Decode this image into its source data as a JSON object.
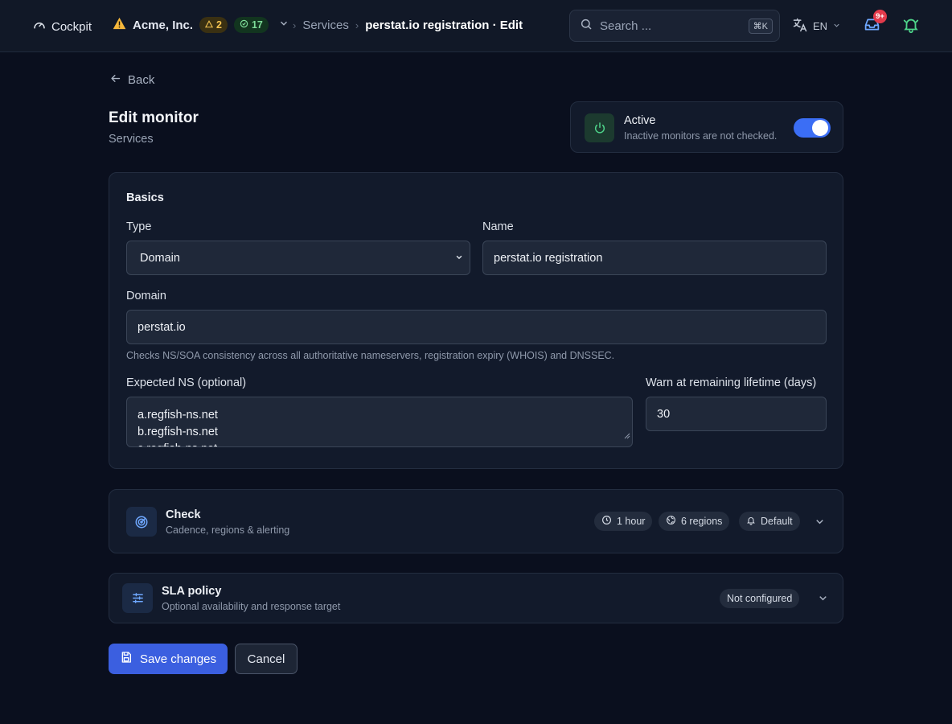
{
  "topbar": {
    "brand": "Cockpit",
    "org_name": "Acme, Inc.",
    "warn_count": "2",
    "ok_count": "17",
    "breadcrumb_parent": "Services",
    "breadcrumb_current": "perstat.io registration · Edit",
    "search_placeholder": "Search ...",
    "search_shortcut": "⌘K",
    "language": "EN",
    "inbox_badge": "9+",
    "icons": [
      "gauge-icon",
      "warning-icon",
      "check-circle-icon",
      "chevron-down-icon",
      "search-icon",
      "translate-icon",
      "inbox-icon",
      "bell-icon"
    ]
  },
  "page": {
    "back_label": "Back",
    "title": "Edit monitor",
    "subtitle": "Services"
  },
  "active": {
    "title": "Active",
    "description": "Inactive monitors are not checked.",
    "enabled": true
  },
  "basics": {
    "title": "Basics",
    "type_label": "Type",
    "type_value": "Domain",
    "name_label": "Name",
    "name_value": "perstat.io registration",
    "domain_label": "Domain",
    "domain_value": "perstat.io",
    "domain_hint": "Checks NS/SOA consistency across all authoritative nameservers, registration expiry (WHOIS) and DNSSEC.",
    "ns_label": "Expected NS (optional)",
    "ns_lines": [
      "a.regfish-ns.net",
      "b.regfish-ns.net",
      "c.regfish-ns.net"
    ],
    "warn_label": "Warn at remaining lifetime (days)",
    "warn_value": "30"
  },
  "check": {
    "title": "Check",
    "subtitle": "Cadence, regions & alerting",
    "cadence": "1 hour",
    "regions": "6 regions",
    "alerting": "Default"
  },
  "sla": {
    "title": "SLA policy",
    "subtitle": "Optional availability and response target",
    "status": "Not configured"
  },
  "actions": {
    "save_label": "Save changes",
    "cancel_label": "Cancel"
  },
  "colors": {
    "accent": "#3b5fe0",
    "toggle_on": "#3b6ef5",
    "warn": "#f5c451",
    "ok": "#7ddc98",
    "badge": "#e23a4b"
  }
}
